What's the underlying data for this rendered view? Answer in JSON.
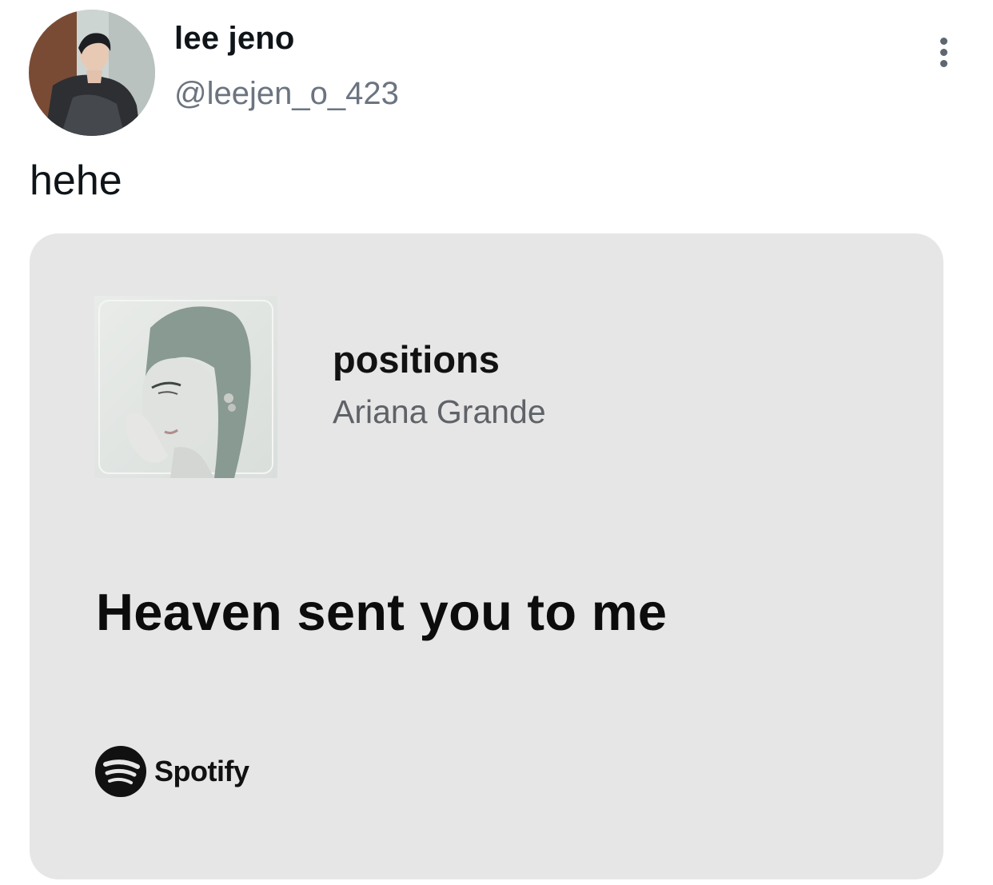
{
  "author": {
    "display_name": "lee jeno",
    "handle": "@leejen_o_423",
    "avatar_icon": "profile-photo"
  },
  "tweet": {
    "text": "hehe"
  },
  "more_icon": "more-vertical-icon",
  "spotify_card": {
    "song_title": "positions",
    "artist": "Ariana Grande",
    "lyric": "Heaven sent you to me",
    "brand": "Spotify",
    "background_color": "#e6e6e7",
    "brand_color": "#111111"
  }
}
